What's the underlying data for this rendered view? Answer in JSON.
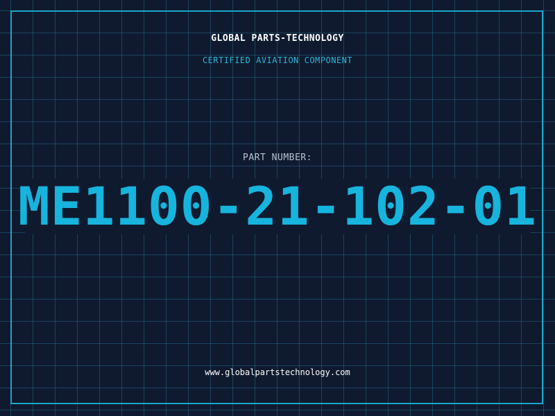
{
  "label": {
    "company": "GLOBAL PARTS-TECHNOLOGY",
    "subtitle": "CERTIFIED AVIATION COMPONENT",
    "part_label": "PART NUMBER:",
    "part_number": "ME1100-21-102-01",
    "website": "www.globalpartstechnology.com"
  },
  "colors": {
    "background": "#0f1a2e",
    "grid": "#287896",
    "frame": "#1aa7cc",
    "accent": "#17b4dd",
    "text": "#ffffff",
    "muted_text": "#b8c4d2"
  }
}
